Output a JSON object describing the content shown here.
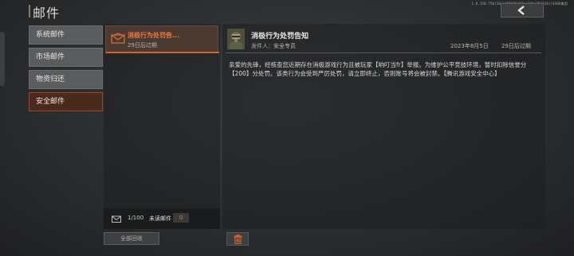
{
  "header": {
    "title": "邮件",
    "version": "1.0.150.750(50)|985978(50)|296(292920)|0400集团"
  },
  "sidebar": {
    "items": [
      {
        "label": "系统邮件",
        "active": false
      },
      {
        "label": "市场邮件",
        "active": false
      },
      {
        "label": "物资归还",
        "active": false
      },
      {
        "label": "安全邮件",
        "active": true
      }
    ]
  },
  "mail_list": {
    "items": [
      {
        "subject": "消极行为处罚告...",
        "expire": "29日后过期"
      }
    ],
    "count": "1/100",
    "unread_label": "未读邮件",
    "unread_count": "0",
    "collect_all_label": "全部回收"
  },
  "detail": {
    "subject": "消极行为处罚告知",
    "sender_prefix": "发件人：",
    "sender_name": "安全专员",
    "date": "2023年8月5日",
    "expire": "29日后过期",
    "body": "亲爱的先锋，经核查您近期存在消极游戏行为且被玩家【响叮当fr】举报。为维护公平竞技环境，暂时扣除信誉分【200】分处罚。该类行为会受到严厉处罚，请立即终止，否则账号将会被封禁。【腾讯游戏安全中心】"
  },
  "colors": {
    "accent": "#d9612e",
    "highlight_text": "#ef7840"
  },
  "icons": [
    "chevron-left-icon",
    "envelope-icon",
    "trash-icon",
    "avatar"
  ]
}
